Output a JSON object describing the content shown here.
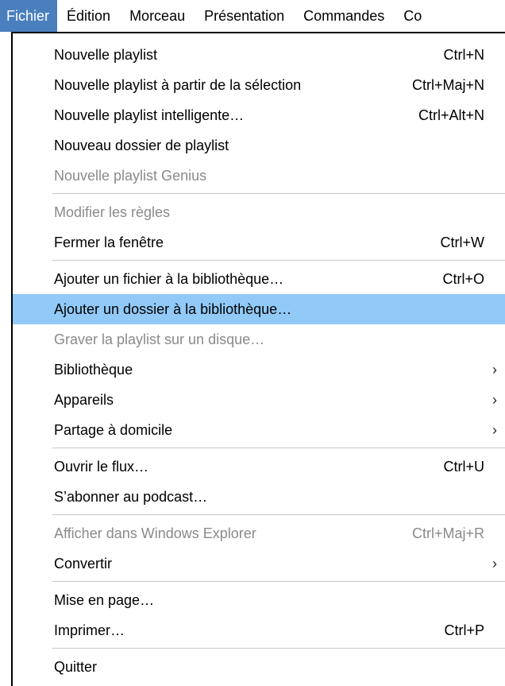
{
  "menubar": {
    "items": [
      {
        "label": "Fichier"
      },
      {
        "label": "Édition"
      },
      {
        "label": "Morceau"
      },
      {
        "label": "Présentation"
      },
      {
        "label": "Commandes"
      },
      {
        "label": "Co"
      }
    ]
  },
  "menu": {
    "groups": [
      [
        {
          "label": "Nouvelle playlist",
          "shortcut": "Ctrl+N"
        },
        {
          "label": "Nouvelle playlist à partir de la sélection",
          "shortcut": "Ctrl+Maj+N"
        },
        {
          "label": "Nouvelle playlist intelligente…",
          "shortcut": "Ctrl+Alt+N"
        },
        {
          "label": "Nouveau dossier de playlist",
          "shortcut": ""
        },
        {
          "label": "Nouvelle playlist Genius",
          "shortcut": "",
          "disabled": true
        }
      ],
      [
        {
          "label": "Modifier les règles",
          "shortcut": "",
          "disabled": true
        },
        {
          "label": "Fermer la fenêtre",
          "shortcut": "Ctrl+W"
        }
      ],
      [
        {
          "label": "Ajouter un fichier à la bibliothèque…",
          "shortcut": "Ctrl+O"
        },
        {
          "label": "Ajouter un dossier à la bibliothèque…",
          "shortcut": "",
          "highlighted": true
        },
        {
          "label": "Graver la playlist sur un disque…",
          "shortcut": "",
          "disabled": true
        },
        {
          "label": "Bibliothèque",
          "shortcut": "",
          "submenu": true
        },
        {
          "label": "Appareils",
          "shortcut": "",
          "submenu": true
        },
        {
          "label": "Partage à domicile",
          "shortcut": "",
          "submenu": true
        }
      ],
      [
        {
          "label": "Ouvrir le flux…",
          "shortcut": "Ctrl+U"
        },
        {
          "label": "S’abonner au podcast…",
          "shortcut": ""
        }
      ],
      [
        {
          "label": "Afficher dans Windows Explorer",
          "shortcut": "Ctrl+Maj+R",
          "disabled": true
        },
        {
          "label": "Convertir",
          "shortcut": "",
          "submenu": true
        }
      ],
      [
        {
          "label": "Mise en page…",
          "shortcut": ""
        },
        {
          "label": "Imprimer…",
          "shortcut": "Ctrl+P"
        }
      ],
      [
        {
          "label": "Quitter",
          "shortcut": ""
        }
      ]
    ],
    "submenu_glyph": "›",
    "submenu_icon": "chevron-right-icon"
  },
  "colors": {
    "active_menu_bg": "#4a7fbe",
    "highlight_bg": "#91c9f7",
    "disabled_text": "#8a8a8a"
  }
}
